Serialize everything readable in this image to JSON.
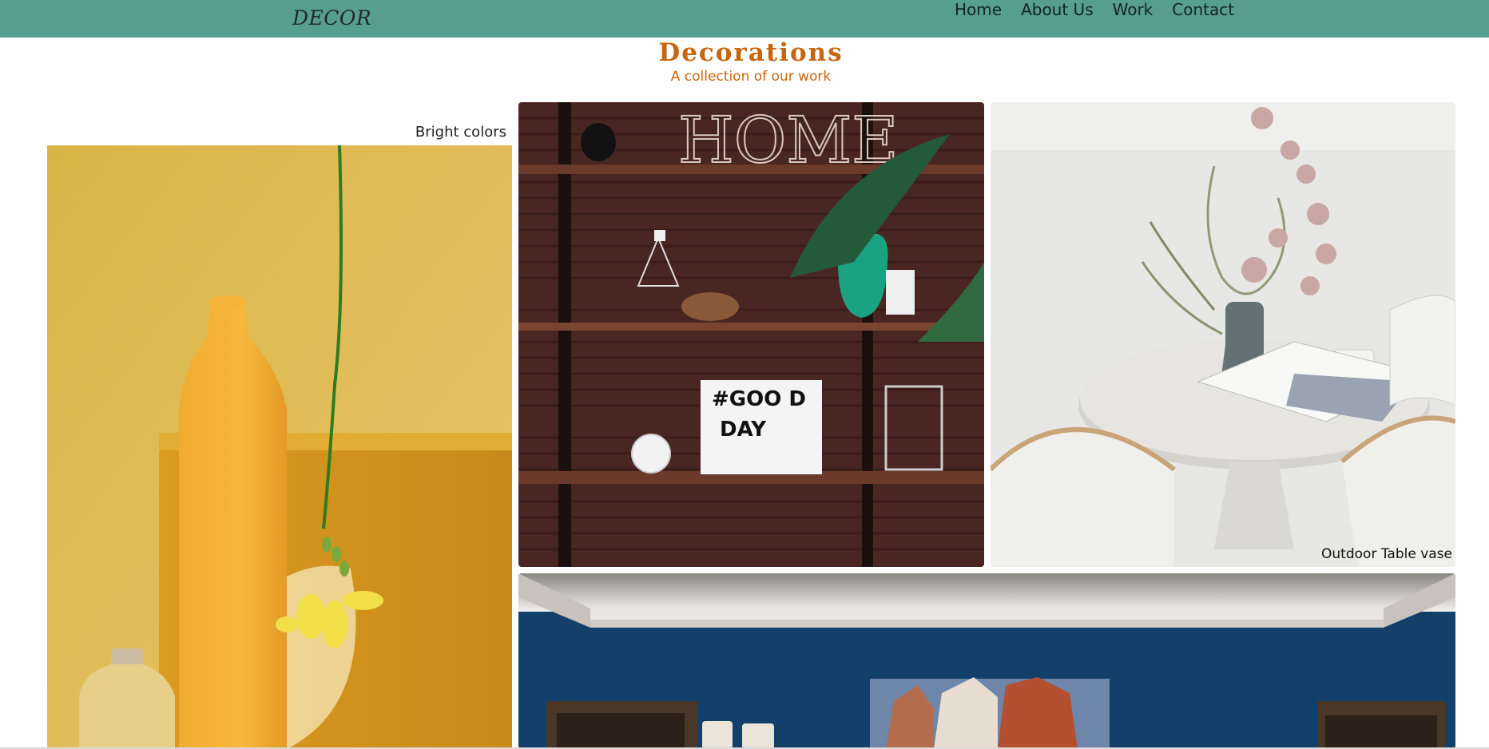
{
  "nav": {
    "brand": "DECOR",
    "links": [
      "Home",
      "About Us",
      "Work",
      "Contact"
    ]
  },
  "header": {
    "title": "Decorations",
    "subtitle": "A collection of our work"
  },
  "gallery": {
    "caption_left": "Bright colors",
    "caption_right": "Outdoor Table vase",
    "lightbox_text_line1": "#GOO D",
    "lightbox_text_line2": "DAY",
    "shelf_sign": "HOME"
  },
  "colors": {
    "nav_bg": "#579e8e",
    "accent": "#c8650f"
  }
}
